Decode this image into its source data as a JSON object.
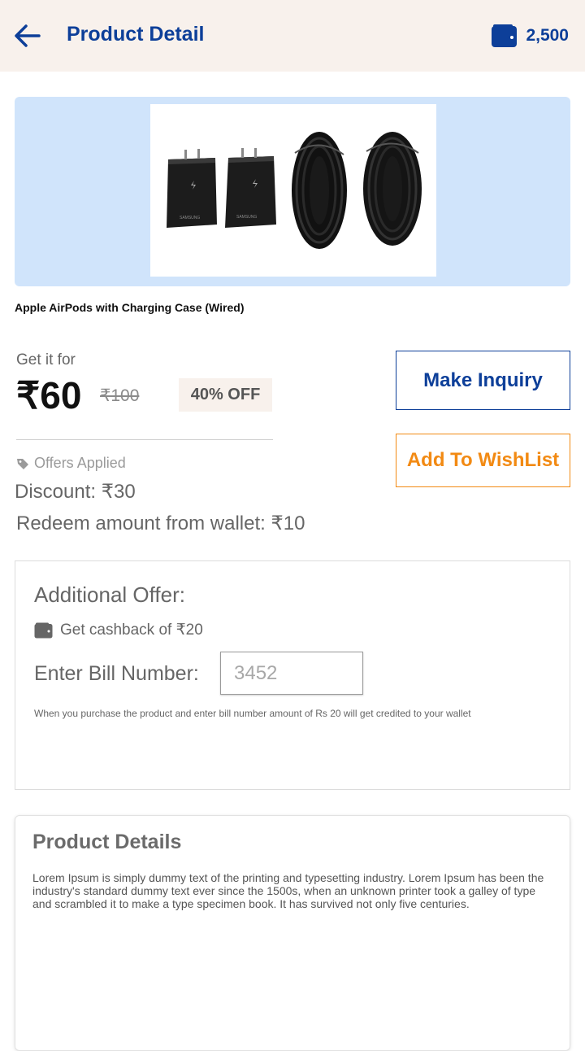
{
  "header": {
    "title": "Product Detail",
    "wallet_balance": "2,500",
    "accent": "#0d3f99"
  },
  "product": {
    "name": "Apple AirPods with Charging Case (Wired)",
    "image_alt": "Samsung chargers and cables"
  },
  "pricing": {
    "get_it_for": "Get it for",
    "price": "₹60",
    "original_price": "₹100",
    "discount_badge": "40% OFF"
  },
  "actions": {
    "inquiry_label": "Make Inquiry",
    "wishlist_label": "Add To WishList"
  },
  "offers": {
    "label": "Offers Applied",
    "discount": "Discount: ₹30",
    "redeem": "Redeem amount from wallet: ₹10"
  },
  "additional_offer": {
    "title": "Additional Offer:",
    "cashback": "Get cashback of ₹20",
    "bill_label": "Enter Bill Number:",
    "bill_placeholder": "3452",
    "note": "When you purchase the product and enter bill number amount of Rs 20 will get credited to your wallet"
  },
  "details": {
    "title": "Product Details",
    "body": "Lorem Ipsum is simply dummy text of the printing and typesetting industry. Lorem Ipsum has been the industry's standard dummy text ever since the 1500s, when an unknown printer took a galley of type and scrambled it to make a type specimen book. It has survived not only five centuries."
  },
  "icons": {
    "back": "arrow-left-icon",
    "wallet": "wallet-icon",
    "tag": "tag-icon"
  }
}
